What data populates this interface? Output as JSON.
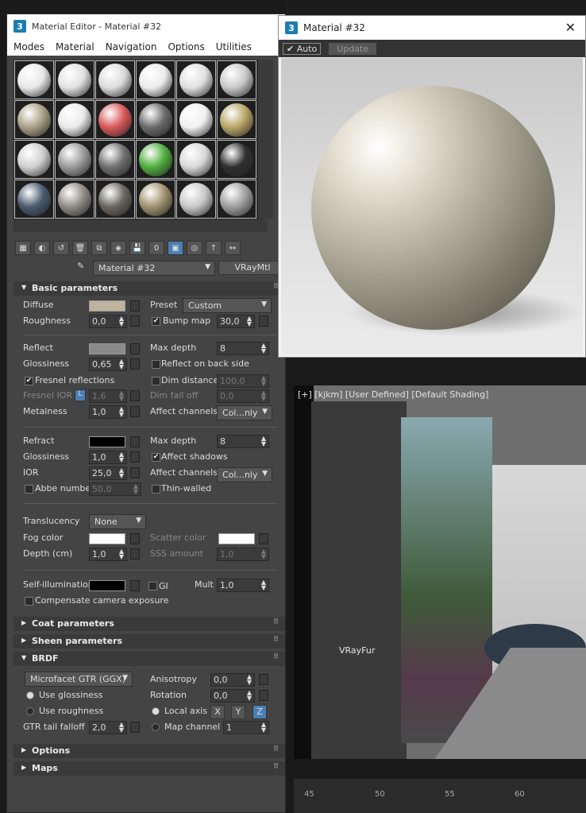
{
  "viewport": {
    "label": "[+] [kjkm] [User Defined] [Default Shading]",
    "object_label": "VRayFur",
    "ruler_ticks": [
      "45",
      "50",
      "55",
      "60"
    ]
  },
  "editor": {
    "title": "Material Editor - Material #32",
    "menu": [
      "Modes",
      "Material",
      "Navigation",
      "Options",
      "Utilities"
    ],
    "swatch_colors": [
      "#e8e8e8",
      "#e2e2e2",
      "#dcdcdc",
      "#ececec",
      "#e0e0e0",
      "#c9c9c9",
      "#a89f85",
      "#eaeaea",
      "#d85858",
      "#6a6a6a",
      "#f0f0f0",
      "#b7a466",
      "#cfcfcf",
      "#9a9a9a",
      "#6f6f6f",
      "#4fae3e",
      "#d8d8d8",
      "#2f2f2f",
      "#4a5a6e",
      "#8f8a84",
      "#6b6560",
      "#a0926e",
      "#c8c8c8",
      "#9e9e9e"
    ],
    "toolbar_icons": [
      "put-to-scene-icon",
      "assign-icon",
      "reset-icon",
      "delete-icon",
      "copy-icon",
      "unique-icon",
      "save-icon",
      "id-icon",
      "show-map-icon",
      "show-end-icon",
      "go-parent-icon",
      "go-sibling-icon"
    ],
    "id_value": "0",
    "material_name": "Material #32",
    "material_type": "VRayMtl",
    "basic": {
      "title": "Basic parameters",
      "diffuse": "Diffuse",
      "diffuse_color": "#bdb39e",
      "roughness": "Roughness",
      "roughness_val": "0,0",
      "preset": "Preset",
      "preset_val": "Custom",
      "bump": "Bump map",
      "bump_val": "30,0",
      "reflect": "Reflect",
      "reflect_color": "#8a8a8a",
      "max_depth": "Max depth",
      "refl_depth": "8",
      "glossiness": "Glossiness",
      "refl_gloss": "0,65",
      "reflect_back": "Reflect on back side",
      "fresnel": "Fresnel reflections",
      "dim_distance": "Dim distance",
      "dim_distance_val": "100,0",
      "fresnel_ior": "Fresnel IOR",
      "l_label": "L",
      "fresnel_ior_val": "1,6",
      "dim_falloff": "Dim fall off",
      "dim_falloff_val": "0,0",
      "metalness": "Metalness",
      "metalness_val": "1,0",
      "affect_channels": "Affect channels",
      "affect_val": "Col...nly",
      "refract": "Refract",
      "refract_color": "#000000",
      "refr_depth": "8",
      "refr_gloss": "1,0",
      "affect_shadows": "Affect shadows",
      "ior": "IOR",
      "ior_val": "25,0",
      "abbe": "Abbe number",
      "abbe_val": "50,0",
      "thin_walled": "Thin-walled",
      "translucency": "Translucency",
      "translucency_val": "None",
      "fog_color": "Fog color",
      "fog_swatch": "#ffffff",
      "scatter_color": "Scatter color",
      "scatter_swatch": "#ffffff",
      "depth": "Depth (cm)",
      "depth_val": "1,0",
      "sss_amount": "SSS amount",
      "sss_val": "1,0",
      "self_illum": "Self-illumination",
      "self_illum_color": "#000000",
      "gi": "GI",
      "mult": "Mult",
      "mult_val": "1,0",
      "compensate": "Compensate camera exposure"
    },
    "coat": "Coat parameters",
    "sheen": "Sheen parameters",
    "brdf": {
      "title": "BRDF",
      "type": "Microfacet GTR (GGX)",
      "anisotropy": "Anisotropy",
      "aniso_val": "0,0",
      "use_gloss": "Use glossiness",
      "rotation": "Rotation",
      "rotation_val": "0,0",
      "use_rough": "Use roughness",
      "local_axis": "Local axis",
      "x": "X",
      "y": "Y",
      "z": "Z",
      "gtr": "GTR tail falloff",
      "gtr_val": "2,0",
      "map_channel": "Map channel",
      "map_channel_val": "1"
    },
    "options": "Options",
    "maps": "Maps"
  },
  "preview": {
    "title": "Material #32",
    "auto": "Auto",
    "update": "Update",
    "close": "✕"
  }
}
